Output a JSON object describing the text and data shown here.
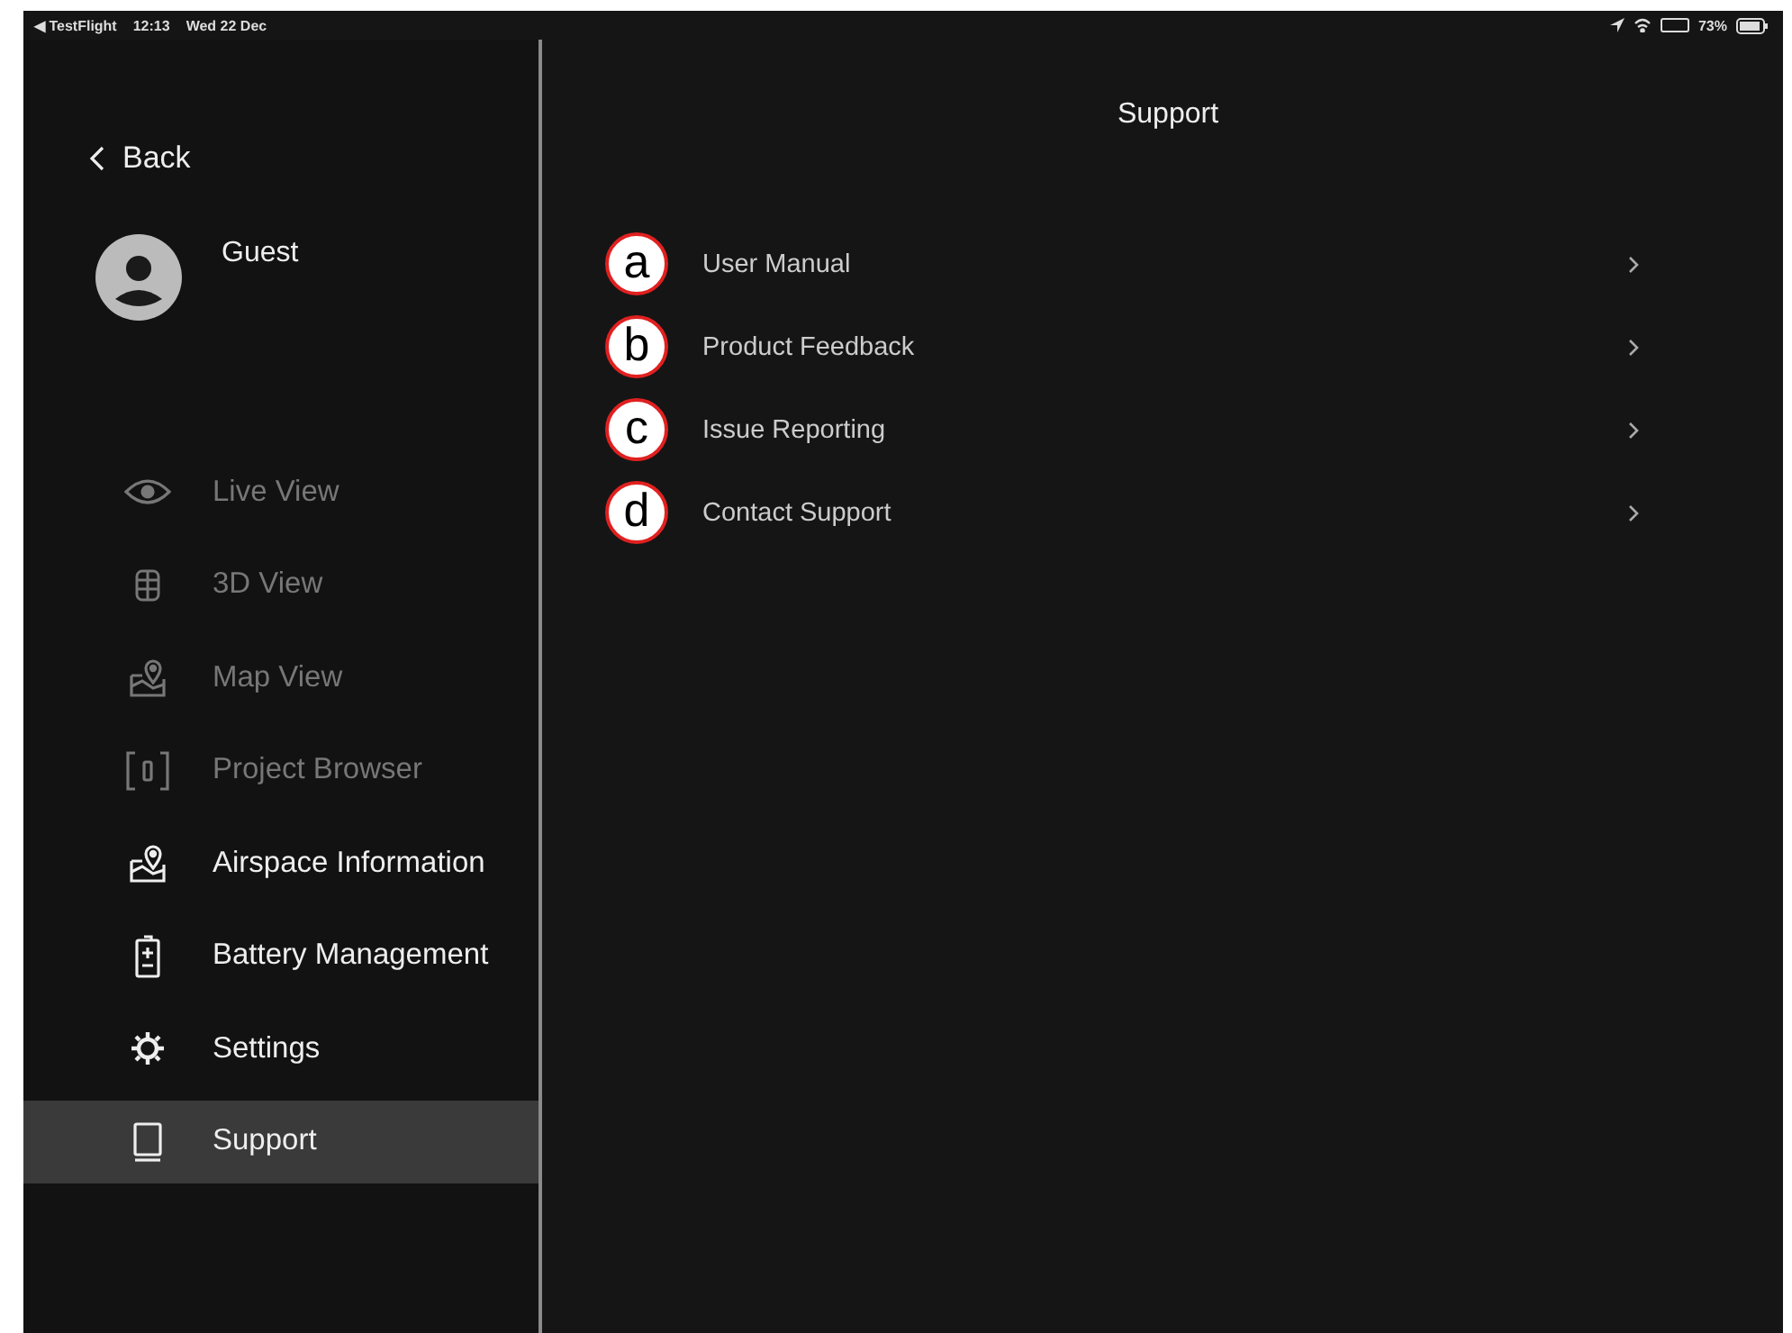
{
  "status_bar": {
    "back_app": "◀ TestFlight",
    "time": "12:13",
    "date": "Wed 22 Dec",
    "battery": "73%"
  },
  "sidebar": {
    "back": "Back",
    "user": "Guest",
    "items": [
      {
        "label": "Live View",
        "disabled": true,
        "selected": false
      },
      {
        "label": "3D View",
        "disabled": true,
        "selected": false
      },
      {
        "label": "Map View",
        "disabled": true,
        "selected": false
      },
      {
        "label": "Project Browser",
        "disabled": true,
        "selected": false
      },
      {
        "label": "Airspace Information",
        "disabled": false,
        "selected": false
      },
      {
        "label": "Battery Management",
        "disabled": false,
        "selected": false
      },
      {
        "label": "Settings",
        "disabled": false,
        "selected": false
      },
      {
        "label": "Support",
        "disabled": false,
        "selected": true
      }
    ]
  },
  "main": {
    "title": "Support",
    "items": [
      {
        "marker": "a",
        "label": "User Manual"
      },
      {
        "marker": "b",
        "label": "Product Feedback"
      },
      {
        "marker": "c",
        "label": "Issue Reporting"
      },
      {
        "marker": "d",
        "label": "Contact Support"
      }
    ]
  }
}
